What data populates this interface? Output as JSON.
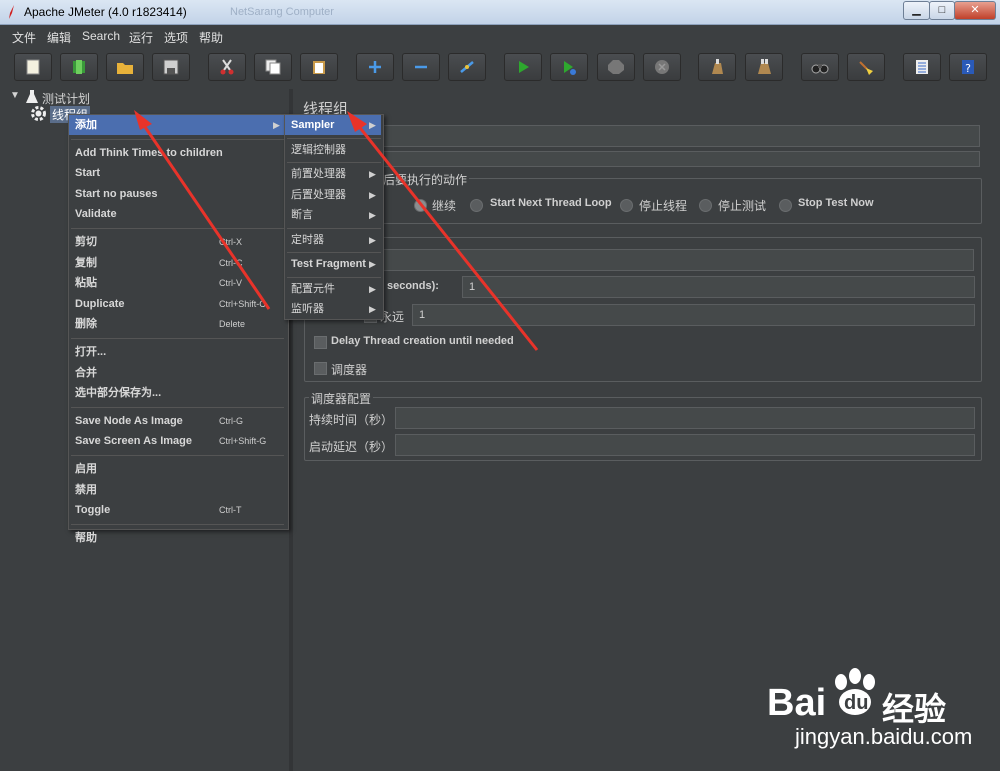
{
  "window": {
    "title": "Apache JMeter (4.0 r1823414)",
    "ghost_title": "NetSarang Computer",
    "min": "▁",
    "max": "□",
    "close": "✕"
  },
  "menu": [
    "文件",
    "编辑",
    "Search",
    "运行",
    "选项",
    "帮助"
  ],
  "toolbar_icons": [
    "new-icon",
    "templates-icon",
    "open-icon",
    "save-icon",
    "cut-icon",
    "copy-icon",
    "paste-icon",
    "expand-icon",
    "collapse-icon",
    "toggle-icon",
    "start-icon",
    "start-no-pause-icon",
    "stop-icon",
    "shutdown-icon",
    "clear-icon",
    "clear-all-icon",
    "search-icon",
    "reset-search-icon",
    "function-helper-icon",
    "help-icon"
  ],
  "tree": {
    "root": "测试计划",
    "child": "线程组"
  },
  "context_menu": {
    "items": [
      {
        "label": "添加",
        "shortcut": "",
        "submenu": true,
        "highlighted": true
      },
      {
        "sep": true
      },
      {
        "label": "Add Think Times to children",
        "shortcut": ""
      },
      {
        "label": "Start",
        "shortcut": ""
      },
      {
        "label": "Start no pauses",
        "shortcut": ""
      },
      {
        "label": "Validate",
        "shortcut": ""
      },
      {
        "sep": true
      },
      {
        "label": "剪切",
        "shortcut": "Ctrl-X"
      },
      {
        "label": "复制",
        "shortcut": "Ctrl-C"
      },
      {
        "label": "粘贴",
        "shortcut": "Ctrl-V"
      },
      {
        "label": "Duplicate",
        "shortcut": "Ctrl+Shift-C"
      },
      {
        "label": "删除",
        "shortcut": "Delete"
      },
      {
        "sep": true
      },
      {
        "label": "打开...",
        "shortcut": ""
      },
      {
        "label": "合并",
        "shortcut": ""
      },
      {
        "label": "选中部分保存为...",
        "shortcut": ""
      },
      {
        "sep": true
      },
      {
        "label": "Save Node As Image",
        "shortcut": "Ctrl-G"
      },
      {
        "label": "Save Screen As Image",
        "shortcut": "Ctrl+Shift-G"
      },
      {
        "sep": true
      },
      {
        "label": "启用",
        "shortcut": ""
      },
      {
        "label": "禁用",
        "shortcut": ""
      },
      {
        "label": "Toggle",
        "shortcut": "Ctrl-T"
      },
      {
        "sep": true
      },
      {
        "label": "帮助",
        "shortcut": ""
      }
    ]
  },
  "submenu": {
    "items": [
      {
        "label": "Sampler",
        "submenu": true
      },
      {
        "sep": true
      },
      {
        "label": "逻辑控制器",
        "submenu": false
      },
      {
        "sep": true
      },
      {
        "label": "前置处理器",
        "submenu": true
      },
      {
        "label": "后置处理器",
        "submenu": true
      },
      {
        "label": "断言",
        "submenu": true
      },
      {
        "sep": true
      },
      {
        "label": "定时器",
        "submenu": true
      },
      {
        "sep": true
      },
      {
        "label": "Test Fragment",
        "submenu": true
      },
      {
        "sep": true
      },
      {
        "label": "配置元件",
        "submenu": true
      },
      {
        "label": "监听器",
        "submenu": true
      }
    ]
  },
  "panel": {
    "title": "线程组",
    "action_group_label": "后要执行的动作",
    "actions": [
      "继续",
      "Start Next Thread Loop",
      "停止线程",
      "停止测试",
      "Stop Test Now"
    ],
    "ramp_label": "od (in seconds):",
    "ramp_value": "1",
    "loop_label": "永远",
    "loop_value": "1",
    "delay_label": "Delay Thread creation until needed",
    "scheduler_label": "调度器",
    "scheduler_section": "调度器配置",
    "duration_label": "持续时间（秒）",
    "startup_delay_label": "启动延迟（秒）"
  },
  "watermark": {
    "brand": "Bai",
    "brand2": "du",
    "cn": "经验",
    "url": "jingyan.baidu.com"
  },
  "colors": {
    "bg": "#3c3f41",
    "highlight": "#4b6eaf",
    "arrow": "#e8332a"
  }
}
